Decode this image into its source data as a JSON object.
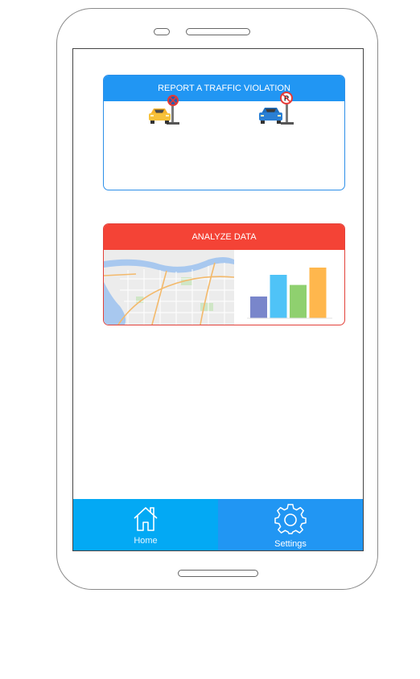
{
  "report_card": {
    "title": "REPORT A TRAFFIC VIOLATION",
    "icons": [
      "no-stopping-car-icon",
      "no-parking-car-icon"
    ]
  },
  "analyze_card": {
    "title": "ANALYZE DATA",
    "thumbnails": [
      "map-thumbnail",
      "bar-chart-thumbnail"
    ],
    "chart_values": [
      30,
      60,
      46,
      70
    ],
    "chart_colors": [
      "#7986cb",
      "#4fc3f7",
      "#8fd06f",
      "#ffb74d"
    ]
  },
  "tabs": [
    {
      "label": "Home",
      "icon": "home-icon"
    },
    {
      "label": "Settings",
      "icon": "gear-icon"
    }
  ],
  "colors": {
    "report_accent": "#2196f3",
    "analyze_accent": "#f44336",
    "tab_home": "#03a9f4",
    "tab_settings": "#2196f3"
  }
}
